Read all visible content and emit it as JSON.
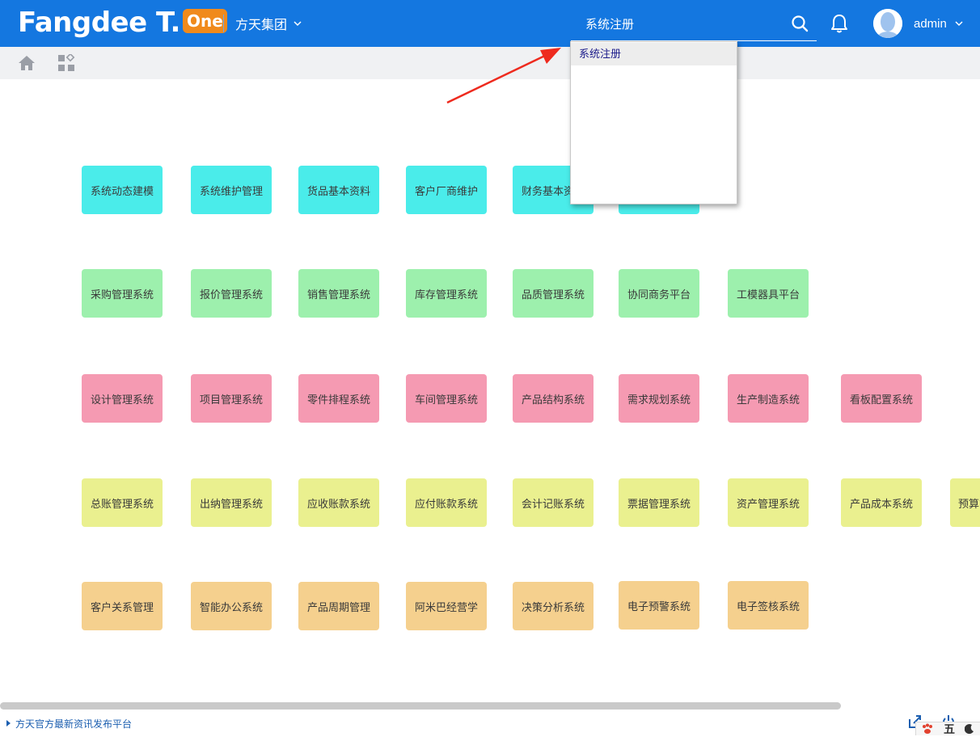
{
  "brand": {
    "name": "Fangdee T.",
    "badge": "One"
  },
  "header": {
    "company": "方天集团",
    "user": "admin"
  },
  "search": {
    "value": "系统注册",
    "suggestions": [
      "系统注册"
    ]
  },
  "tiles": {
    "row1": [
      "系统动态建模",
      "系统维护管理",
      "货品基本资料",
      "客户厂商维护",
      "财务基本资料",
      ""
    ],
    "row2": [
      "采购管理系统",
      "报价管理系统",
      "销售管理系统",
      "库存管理系统",
      "品质管理系统",
      "协同商务平台",
      "工模器具平台"
    ],
    "row3": [
      "设计管理系统",
      "项目管理系统",
      "零件排程系统",
      "车间管理系统",
      "产品结构系统",
      "需求规划系统",
      "生产制造系统",
      "看板配置系统"
    ],
    "row4": [
      "总账管理系统",
      "出纳管理系统",
      "应收账款系统",
      "应付账款系统",
      "会计记账系统",
      "票据管理系统",
      "资产管理系统",
      "产品成本系统",
      "预算管理系统"
    ],
    "row5": [
      "客户关系管理",
      "智能办公系统",
      "产品周期管理",
      "阿米巴经营学",
      "决策分析系统",
      "电子预警系统",
      "电子签核系统"
    ]
  },
  "colors": {
    "header": "#1477e0",
    "row1": "#4aecea",
    "row2": "#9df0ad",
    "row3": "#f59ab2",
    "row4": "#eaf08f",
    "row5": "#f5d08e",
    "annotation_arrow": "#ee2a1e"
  },
  "footer": {
    "news_link": "方天官方最新资讯发布平台",
    "ime": "五"
  },
  "icons": {
    "search": "search-icon",
    "bell": "bell-icon",
    "home": "home-icon",
    "apps": "apps-icon",
    "share": "share-icon",
    "power": "power-icon"
  }
}
